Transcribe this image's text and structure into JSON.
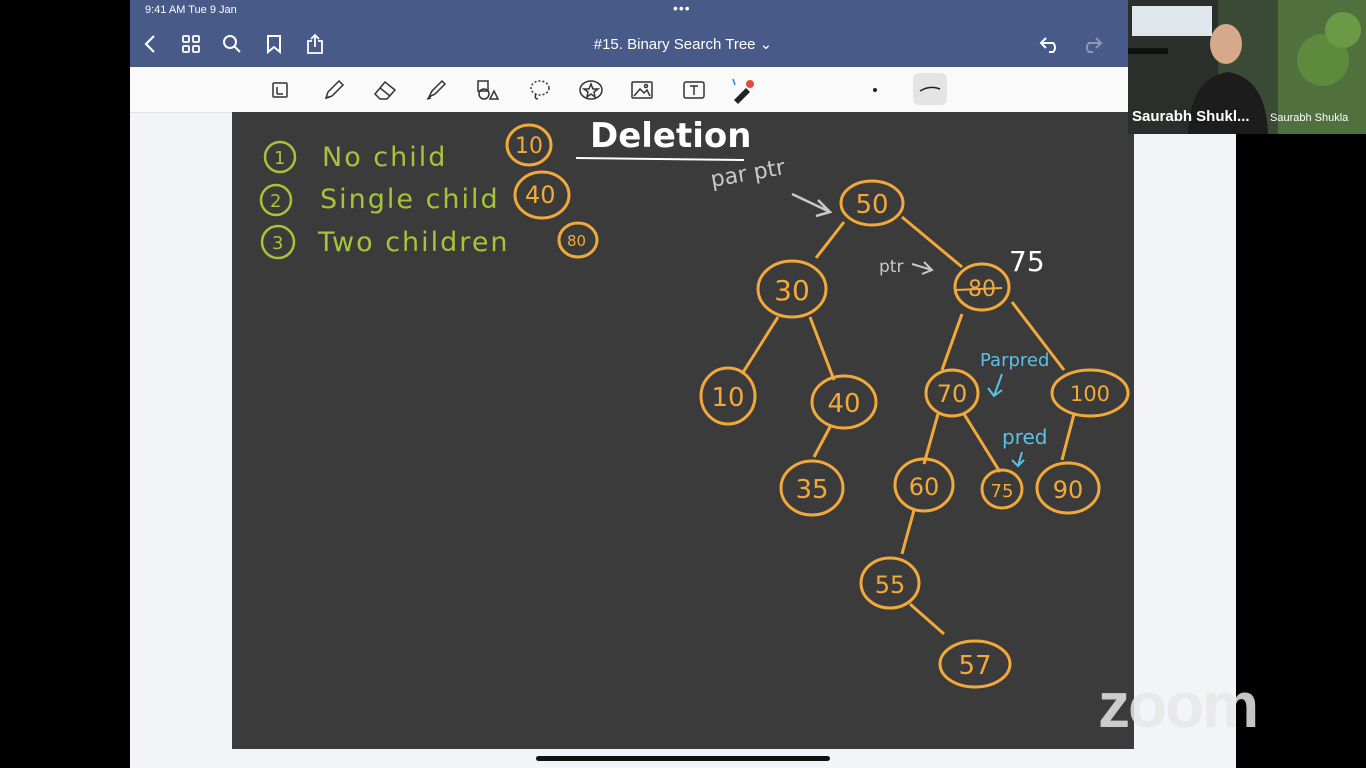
{
  "status": {
    "time": "9:41 AM  Tue 9 Jan",
    "dots": "•••"
  },
  "nav": {
    "title": "#15. Binary Search Tree ⌄"
  },
  "toolbar": {
    "tools": [
      "page-icon",
      "pen-icon",
      "eraser-icon",
      "highlighter-icon",
      "shapes-icon",
      "lasso-icon",
      "sticker-icon",
      "image-icon",
      "text-icon",
      "laser-icon"
    ]
  },
  "notes": {
    "heading": "Deletion",
    "cases": [
      {
        "num": "1",
        "label": "No child",
        "example": "10"
      },
      {
        "num": "2",
        "label": "Single child",
        "example": "40"
      },
      {
        "num": "3",
        "label": "Two children",
        "example": "80"
      }
    ],
    "par_ptr": "par ptr",
    "ptr": "ptr",
    "replacement": "75",
    "parpred": "Parpred",
    "pred": "pred"
  },
  "tree": {
    "nodes": [
      "50",
      "30",
      "80",
      "10",
      "40",
      "70",
      "100",
      "35",
      "60",
      "75",
      "90",
      "55",
      "57"
    ]
  },
  "video": {
    "name": "Saurabh Shukl...",
    "sub": "Saurabh Shukla"
  },
  "zoom": {
    "logo": "zoom"
  },
  "colors": {
    "nav": "#475a88",
    "canvas": "#3b3b3b",
    "ink_green": "#a9c23a",
    "ink_orange": "#f2a93b",
    "ink_blue": "#5cc1e8"
  }
}
